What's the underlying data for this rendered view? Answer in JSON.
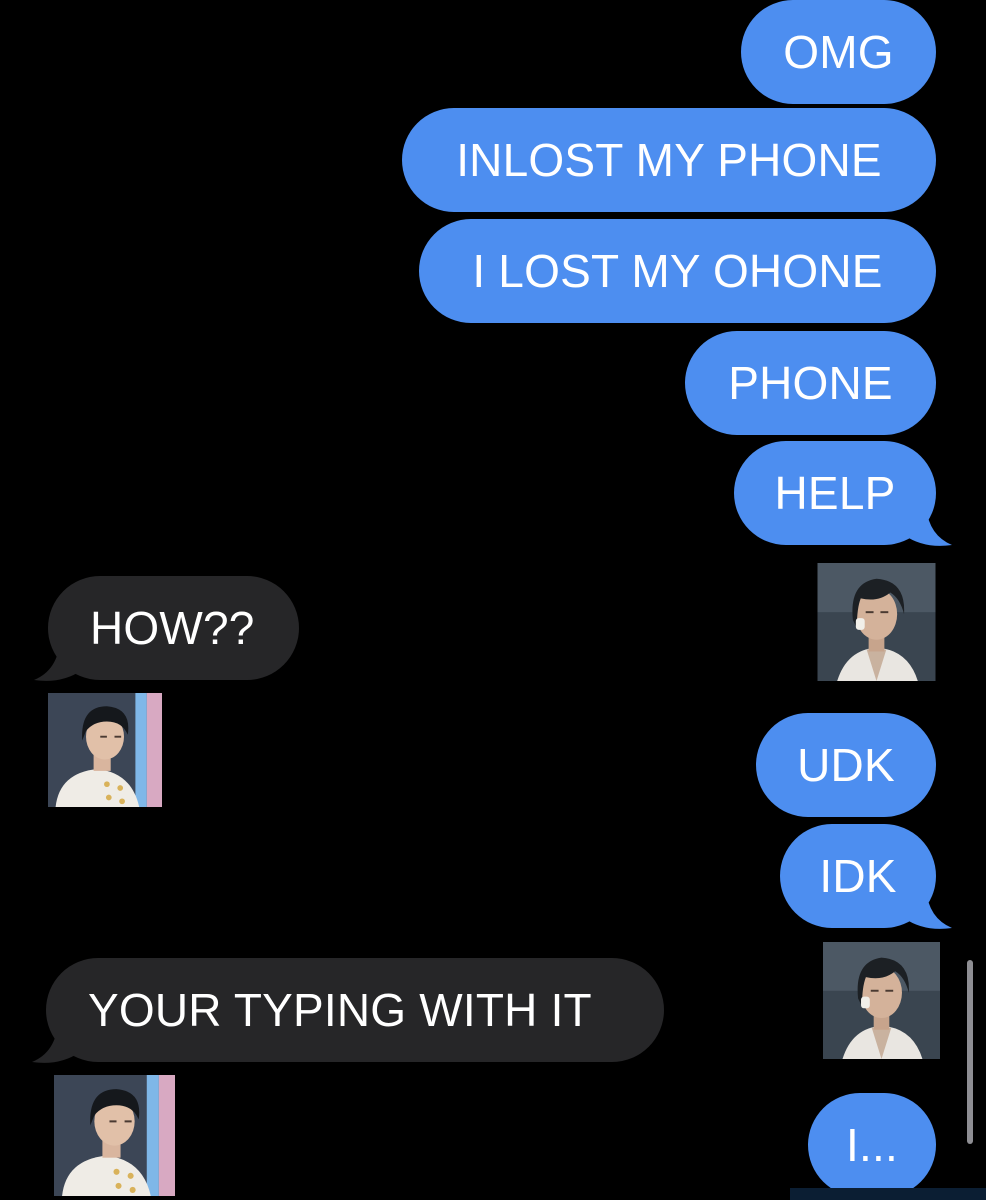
{
  "conversation": {
    "messages": [
      {
        "from": "me",
        "text": "OMG"
      },
      {
        "from": "me",
        "text": "INLOST MY PHONE"
      },
      {
        "from": "me",
        "text": "I LOST MY OHONE"
      },
      {
        "from": "me",
        "text": "PHONE"
      },
      {
        "from": "me",
        "text": "HELP"
      },
      {
        "from": "them",
        "text": "HOW??"
      },
      {
        "from": "me",
        "text": "UDK"
      },
      {
        "from": "me",
        "text": "IDK"
      },
      {
        "from": "them",
        "text": "YOUR TYPING WITH IT"
      },
      {
        "from": "me",
        "text": "I..."
      }
    ],
    "reaction_images": [
      {
        "position": "right",
        "subject": "long-haired man in white shirt"
      },
      {
        "position": "left",
        "subject": "young man in white chef jacket"
      },
      {
        "position": "right",
        "subject": "long-haired man in white shirt"
      },
      {
        "position": "left",
        "subject": "young man in white chef jacket"
      }
    ]
  },
  "colors": {
    "background": "#000000",
    "sent_bubble": "#4d8ef0",
    "received_bubble": "#262628",
    "text": "#ffffff",
    "scrollbar": "#8e8e93"
  },
  "icons": {
    "scroll": "scrollbar-thumb"
  }
}
